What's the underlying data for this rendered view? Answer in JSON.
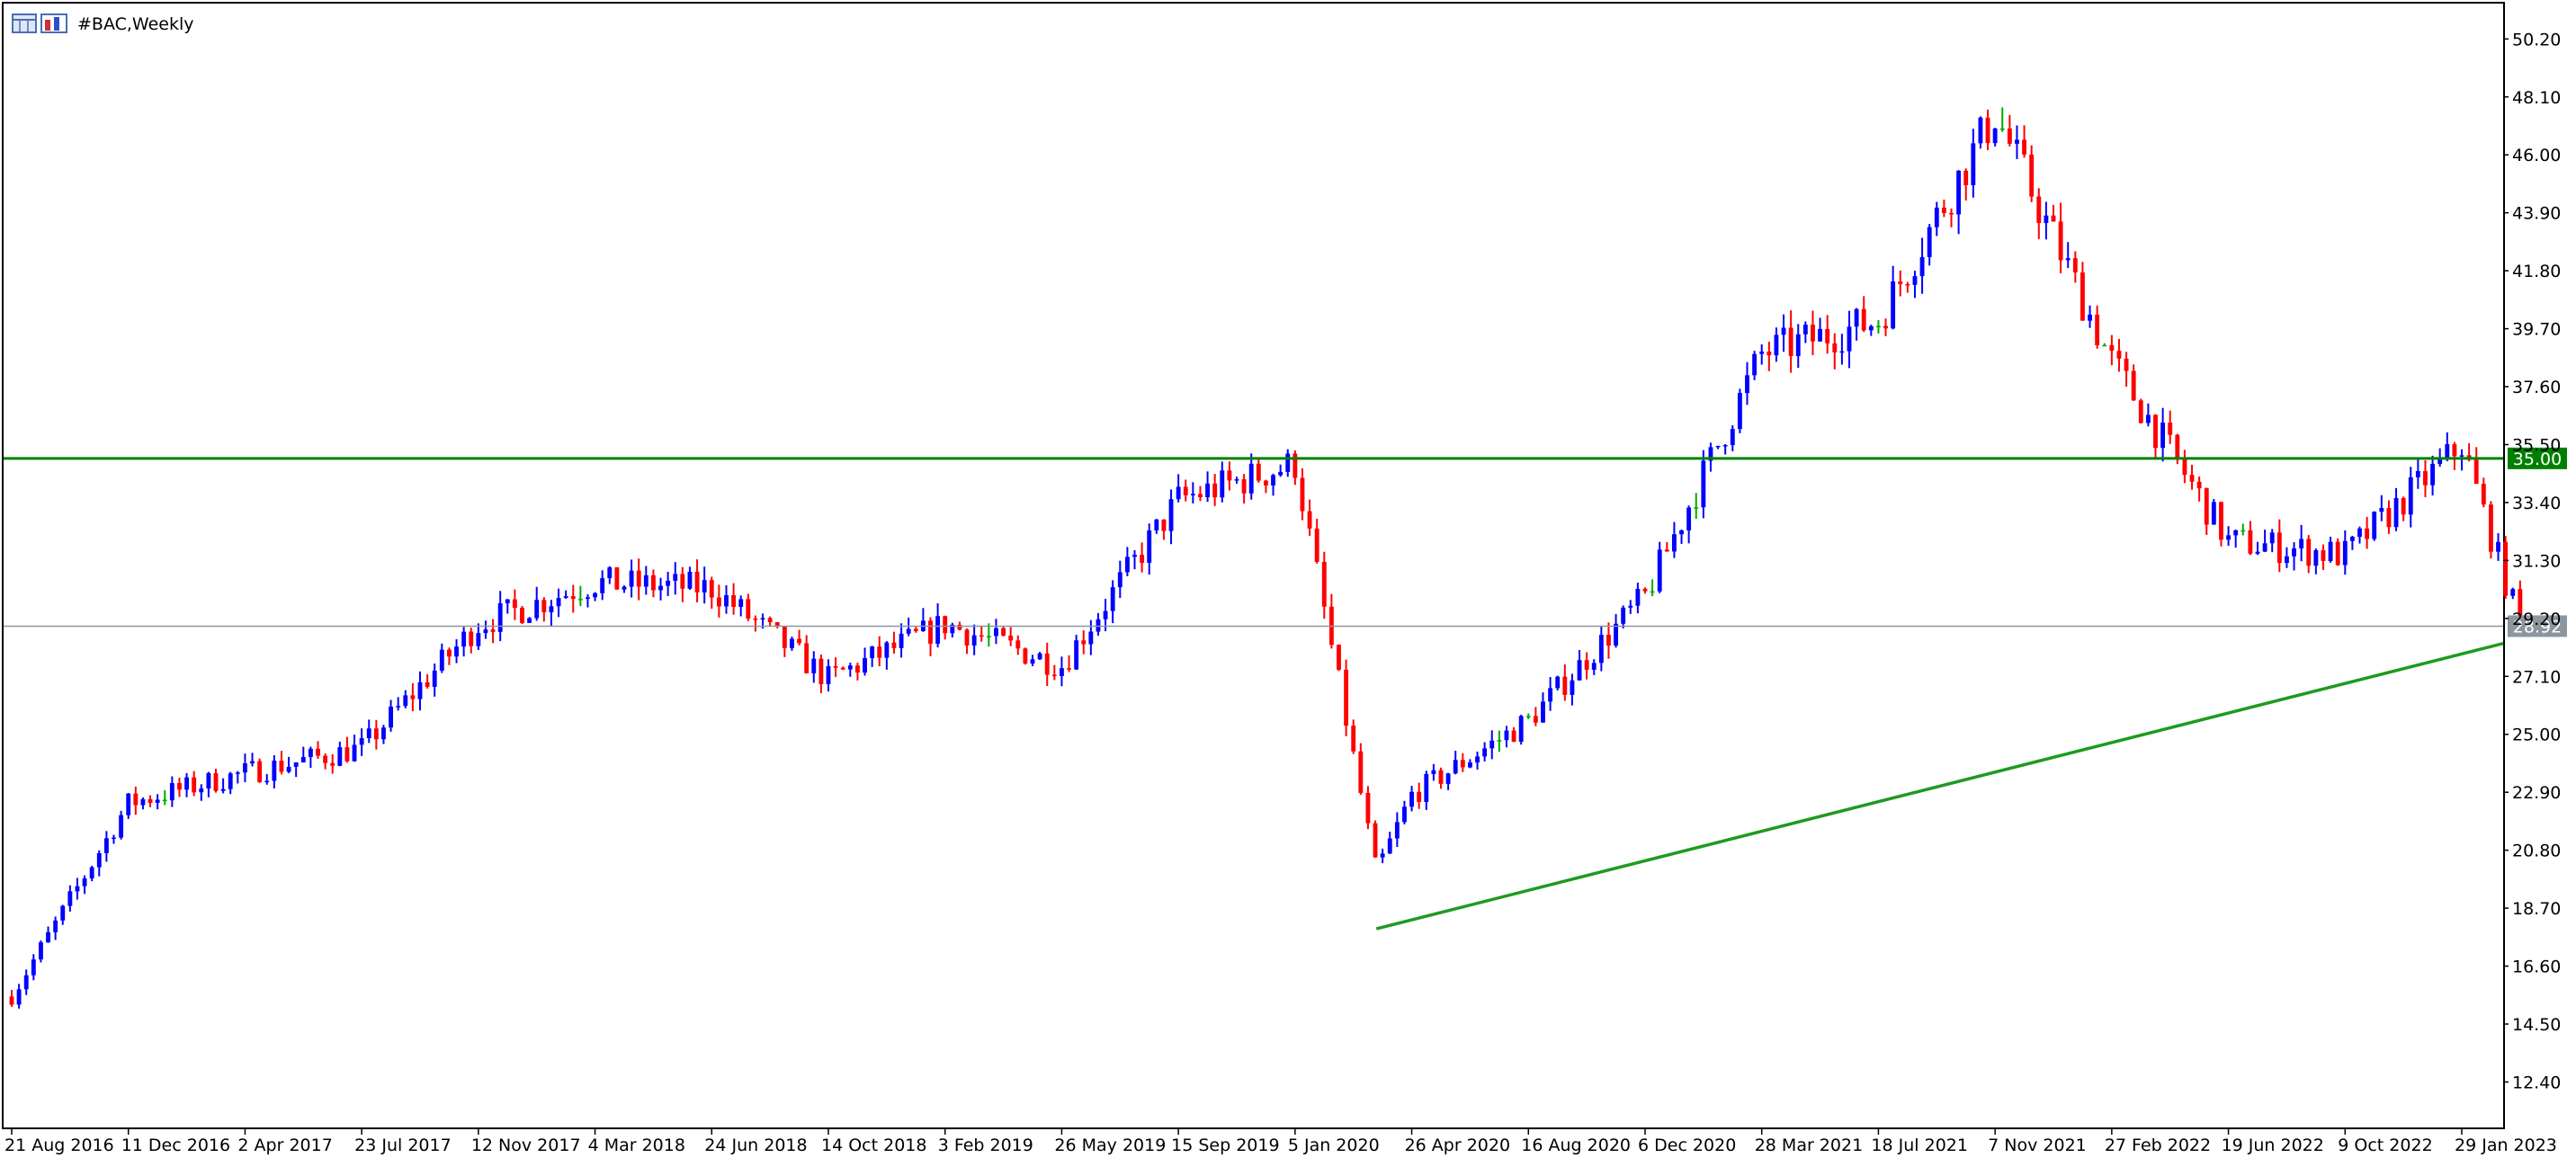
{
  "window": {
    "symbol_title": "#BAC,Weekly"
  },
  "icons": {
    "chart_window": "chart-window-icon",
    "indicator": "indicator-icon"
  },
  "colors": {
    "bull": "#0000ff",
    "bear": "#ff0000",
    "doji": "#00aa00",
    "resistance": "#008000",
    "trendline": "#1f9a1f",
    "current_price_line": "#8c96a0",
    "current_price_tag": "#8c96a0",
    "resistance_tag": "#008000"
  },
  "chart_data": {
    "type": "candlestick",
    "symbol": "#BAC",
    "timeframe": "Weekly",
    "ylim": [
      11.6,
      50.7
    ],
    "y_ticks": [
      "50.20",
      "48.10",
      "46.00",
      "43.90",
      "41.80",
      "39.70",
      "37.60",
      "35.50",
      "33.40",
      "31.30",
      "29.20",
      "27.10",
      "25.00",
      "22.90",
      "20.80",
      "18.70",
      "16.60",
      "14.50",
      "12.40"
    ],
    "x_ticks": [
      "21 Aug 2016",
      "11 Dec 2016",
      "2 Apr 2017",
      "23 Jul 2017",
      "12 Nov 2017",
      "4 Mar 2018",
      "24 Jun 2018",
      "14 Oct 2018",
      "3 Feb 2019",
      "26 May 2019",
      "15 Sep 2019",
      "5 Jan 2020",
      "26 Apr 2020",
      "16 Aug 2020",
      "6 Dec 2020",
      "28 Mar 2021",
      "18 Jul 2021",
      "7 Nov 2021",
      "27 Feb 2022",
      "19 Jun 2022",
      "9 Oct 2022",
      "29 Jan 2023"
    ],
    "horizontal_lines": [
      {
        "name": "resistance",
        "price": 35.0,
        "label": "35.00"
      },
      {
        "name": "current",
        "price": 28.92,
        "label": "28.92"
      }
    ],
    "trendline": {
      "from": {
        "date": "23 Mar 2020",
        "price": 17.95
      },
      "to": {
        "date": "26 Mar 2023",
        "price": 28.45
      }
    },
    "anchors": [
      {
        "date": "21 Aug 2016",
        "price": 15.5
      },
      {
        "date": "11 Dec 2016",
        "price": 22.5
      },
      {
        "date": "2 Apr 2017",
        "price": 23.6
      },
      {
        "date": "23 Jul 2017",
        "price": 24.5
      },
      {
        "date": "12 Nov 2017",
        "price": 29.0
      },
      {
        "date": "4 Mar 2018",
        "price": 30.5
      },
      {
        "date": "24 Jun 2018",
        "price": 30.3
      },
      {
        "date": "14 Oct 2018",
        "price": 27.0
      },
      {
        "date": "3 Feb 2019",
        "price": 29.0
      },
      {
        "date": "26 May 2019",
        "price": 27.5
      },
      {
        "date": "15 Sep 2019",
        "price": 33.5
      },
      {
        "date": "5 Jan 2020",
        "price": 34.8
      },
      {
        "date": "23 Mar 2020",
        "price": 20.0
      },
      {
        "date": "26 Apr 2020",
        "price": 22.8
      },
      {
        "date": "16 Aug 2020",
        "price": 25.5
      },
      {
        "date": "6 Dec 2020",
        "price": 30.0
      },
      {
        "date": "28 Mar 2021",
        "price": 38.8
      },
      {
        "date": "18 Jul 2021",
        "price": 40.0
      },
      {
        "date": "7 Nov 2021",
        "price": 47.5
      },
      {
        "date": "27 Feb 2022",
        "price": 38.5
      },
      {
        "date": "19 Jun 2022",
        "price": 32.0
      },
      {
        "date": "9 Oct 2022",
        "price": 31.5
      },
      {
        "date": "29 Jan 2023",
        "price": 35.5
      },
      {
        "date": "26 Mar 2023",
        "price": 28.92
      }
    ]
  }
}
